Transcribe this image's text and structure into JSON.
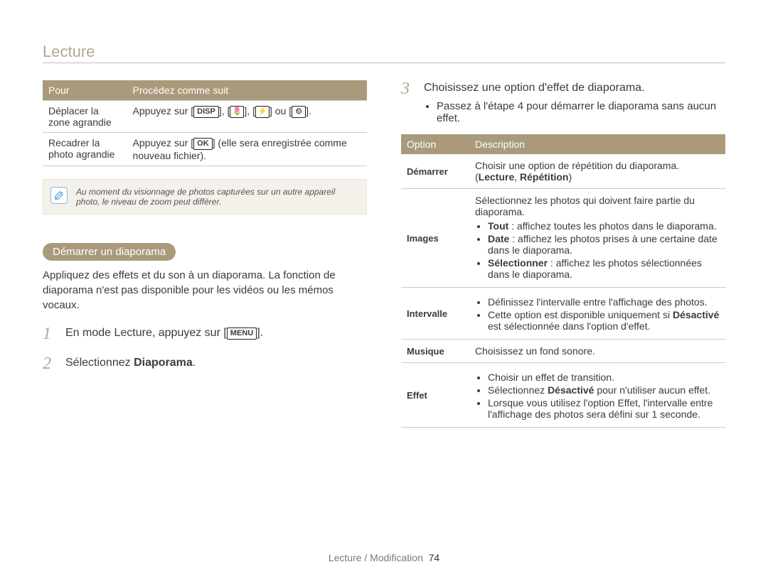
{
  "section_title": "Lecture",
  "table_left": {
    "headers": [
      "Pour",
      "Procédez comme suit"
    ],
    "rows": [
      {
        "c0": "Déplacer la zone agrandie",
        "c1_prefix": "Appuyez sur ",
        "c1_btns": [
          "DISP",
          "🌷",
          "⚡",
          "⏲"
        ],
        "c1_sep": [
          ", ",
          ", ",
          " ou "
        ],
        "c1_suffix": "."
      },
      {
        "c0": "Recadrer la photo agrandie",
        "c1_prefix": "Appuyez sur ",
        "c1_btns": [
          "OK"
        ],
        "c1_suffix": " (elle sera enregistrée comme nouveau fichier)."
      }
    ]
  },
  "note_text": "Au moment du visionnage de photos capturées sur un autre appareil photo, le niveau de zoom peut différer.",
  "pill_title": "Démarrer un diaporama",
  "intro_text": "Appliquez des effets et du son à un diaporama. La fonction de diaporama n'est pas disponible pour les vidéos ou les mémos vocaux.",
  "steps": {
    "s1_num": "1",
    "s1_pre": "En mode Lecture, appuyez sur [",
    "s1_btn": "MENU",
    "s1_post": "].",
    "s2_num": "2",
    "s2_pre": "Sélectionnez ",
    "s2_bold": "Diaporama",
    "s2_post": ".",
    "s3_num": "3",
    "s3_text": "Choisissez une option d'effet de diaporama.",
    "s3_sub": "Passez à l'étape 4 pour démarrer le diaporama sans aucun effet."
  },
  "opts_headers": [
    "Option",
    "Description"
  ],
  "opts": {
    "demarrer": {
      "name": "Démarrer",
      "line1": "Choisir une option de répétition du diaporama.",
      "line2_pre": "(",
      "line2_b1": "Lecture",
      "line2_mid": ", ",
      "line2_b2": "Répétition",
      "line2_post": ")"
    },
    "images": {
      "name": "Images",
      "lead": "Sélectionnez les photos qui doivent faire partie du diaporama.",
      "b1_label": "Tout",
      "b1_rest": " : affichez toutes les photos dans le diaporama.",
      "b2_label": "Date",
      "b2_rest": " : affichez les photos prises à une certaine date dans le diaporama.",
      "b3_label": "Sélectionner",
      "b3_rest": " : affichez les photos sélectionnées dans le diaporama."
    },
    "intervalle": {
      "name": "Intervalle",
      "b1": "Définissez l'intervalle entre l'affichage des photos.",
      "b2_a": "Cette option est disponible uniquement si ",
      "b2_bold": "Désactivé",
      "b2_b": " est sélectionnée dans l'option d'effet."
    },
    "musique": {
      "name": "Musique",
      "text": "Choisissez un fond sonore."
    },
    "effet": {
      "name": "Effet",
      "b1": "Choisir un effet de transition.",
      "b2_a": "Sélectionnez ",
      "b2_bold": "Désactivé",
      "b2_b": " pour n'utiliser aucun effet.",
      "b3": "Lorsque vous utilisez l'option Effet, l'intervalle entre l'affichage des photos sera défini sur 1 seconde."
    }
  },
  "footer_text": "Lecture / Modification",
  "footer_page": "74"
}
